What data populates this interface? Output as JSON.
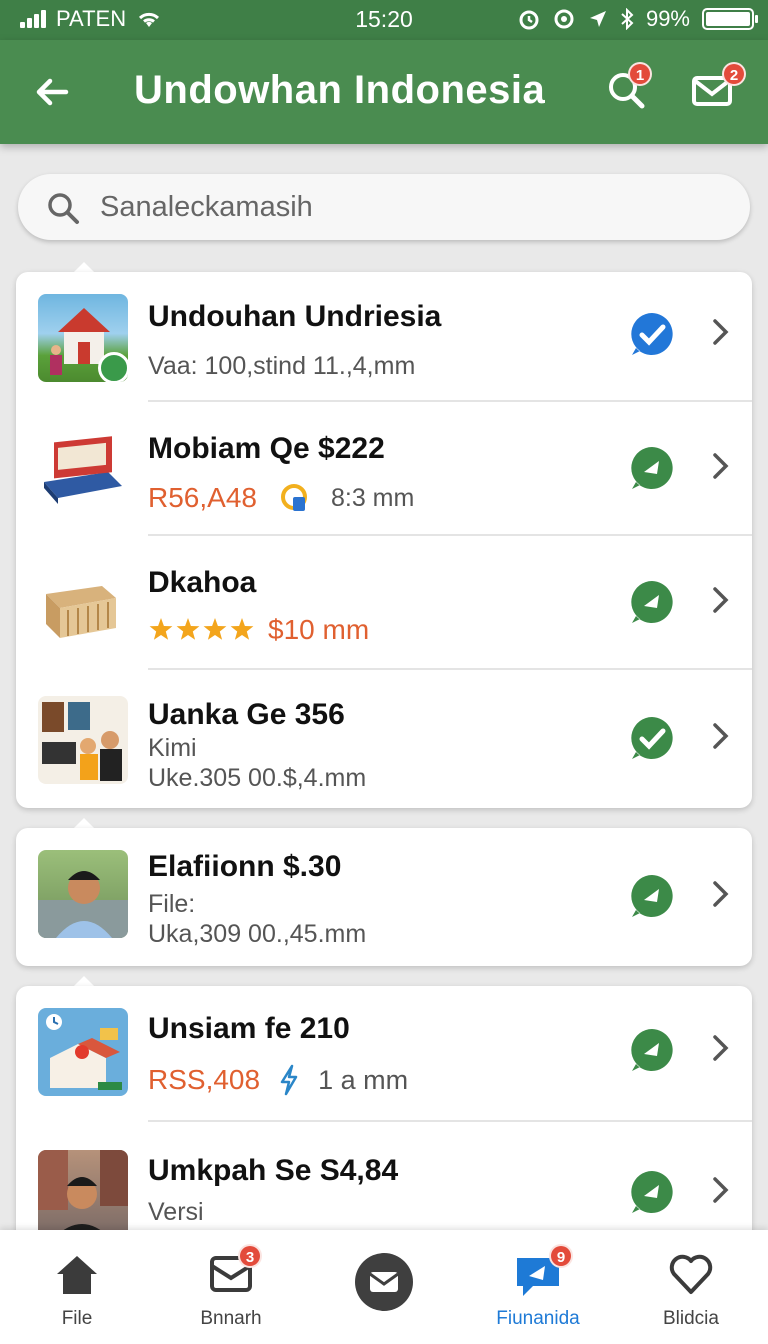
{
  "status_bar": {
    "carrier": "PATEN",
    "time": "15:20",
    "battery": "99%",
    "battery_level": 0.99
  },
  "app_bar": {
    "title": "Undowhan Indonesia",
    "search_badge": "1",
    "mail_badge": "2"
  },
  "search": {
    "placeholder": "Sanaleckamasih"
  },
  "items": [
    {
      "title": "Undouhan Undriesia",
      "subtitle": "Vaa: 100,stind 11.,4,mm",
      "thumb": "building-thumbnail",
      "status_icon": "verified-check-icon"
    },
    {
      "title": "Mobiam Qe $222",
      "price": "R56,A48",
      "meta": "8:3 mm",
      "thumb": "books-thumbnail",
      "status_icon": "chat-bubble-icon"
    },
    {
      "title": "Dkahoa",
      "rating": 4,
      "price": "$10 mm",
      "thumb": "basket-thumbnail",
      "status_icon": "chat-bubble-icon"
    },
    {
      "title": "Uanka Ge 356",
      "line2": "Kimi",
      "line3": "Uke.305 00.$,4.mm",
      "thumb": "people-thumbnail",
      "status_icon": "chat-check-icon"
    },
    {
      "title": "Elafiionn $.30",
      "line2": "File:",
      "line3": "Uka,309 00.,45.mm",
      "thumb": "portrait-thumbnail",
      "status_icon": "chat-bubble-icon"
    },
    {
      "title": "Unsiam fe 210",
      "price": "RSS,408",
      "meta": "1 a mm",
      "thumb": "app-thumbnail",
      "status_icon": "chat-bubble-icon"
    },
    {
      "title": "Umkpah Se S4,84",
      "line2": "Versi",
      "thumb": "portrait-thumbnail",
      "status_icon": "chat-bubble-icon"
    }
  ],
  "bottom_nav": [
    {
      "label": "File",
      "icon": "home-icon"
    },
    {
      "label": "Bnnarh",
      "icon": "mail-icon",
      "badge": "3"
    },
    {
      "label": "",
      "icon": "envelope-circle-icon"
    },
    {
      "label": "Fiunanida",
      "icon": "chat-icon",
      "badge": "9",
      "active": true
    },
    {
      "label": "Blidcia",
      "icon": "heart-icon"
    }
  ],
  "colors": {
    "primary": "#4a8c50",
    "accent_blue": "#1e7ad6",
    "price_orange": "#e06030",
    "badge_red": "#e34b3b"
  }
}
